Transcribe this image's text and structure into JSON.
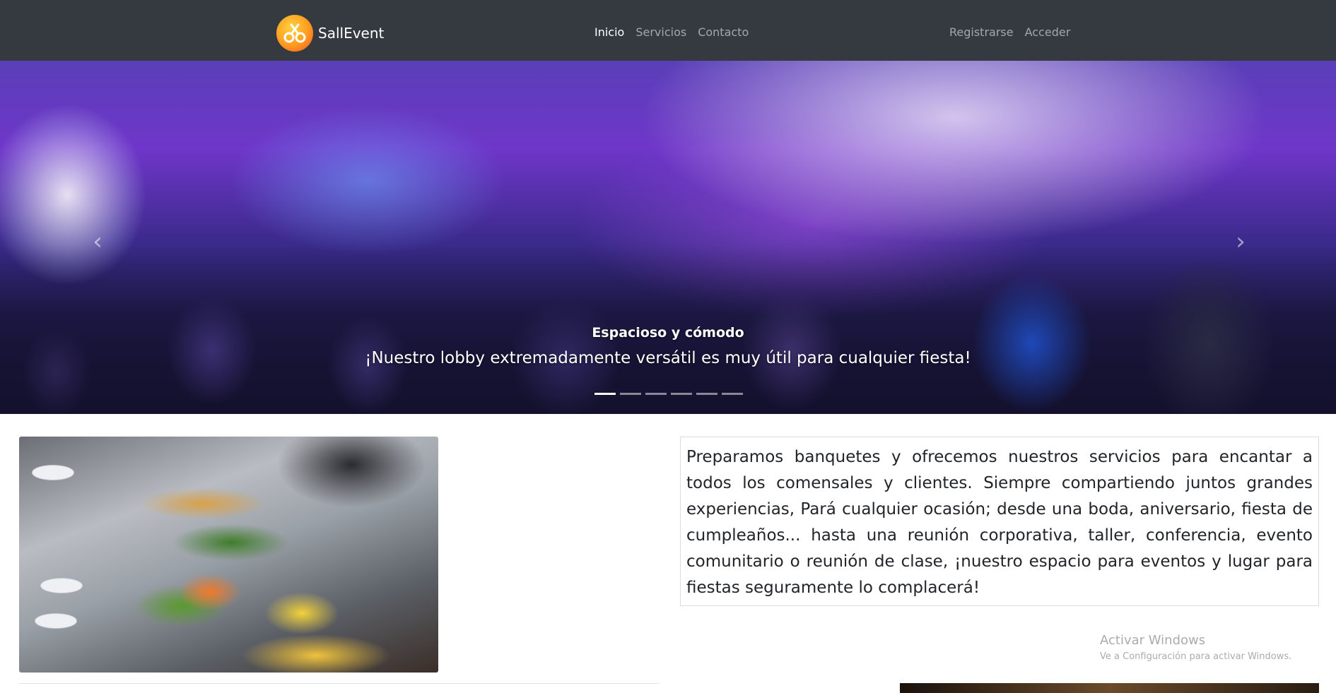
{
  "navbar": {
    "brand_name": "SallEvent",
    "nav_links": [
      "Inicio",
      "Servicios",
      "Contacto"
    ],
    "active_link": "Inicio",
    "auth_links": [
      "Registrarse",
      "Acceder"
    ]
  },
  "carousel": {
    "slide_title": "Espacioso y cómodo",
    "slide_text": "¡Nuestro lobby extremadamente versátil es muy útil para cualquier fiesta!",
    "indicator_count": 6,
    "active_indicator": 1,
    "prev_icon": "‹",
    "next_icon": "›"
  },
  "content": {
    "description": "Preparamos banquetes y ofrecemos nuestros servicios para encantar a todos los comensales y clientes. Siempre compartiendo juntos grandes experiencias, Pará cualquier ocasión; desde una boda, aniversario, fiesta de cumpleaños... hasta una reunión corporativa, taller, conferencia, evento comunitario o reunión de clase, ¡nuestro espacio para eventos y lugar para fiestas seguramente lo complacerá!"
  },
  "watermark": {
    "title": "Activar Windows",
    "subtitle": "Ve a Configuración para activar Windows."
  },
  "colors": {
    "navbar_bg": "#343a40",
    "nav_active": "#ffffff",
    "nav_inactive": "rgba(255,255,255,0.55)"
  }
}
